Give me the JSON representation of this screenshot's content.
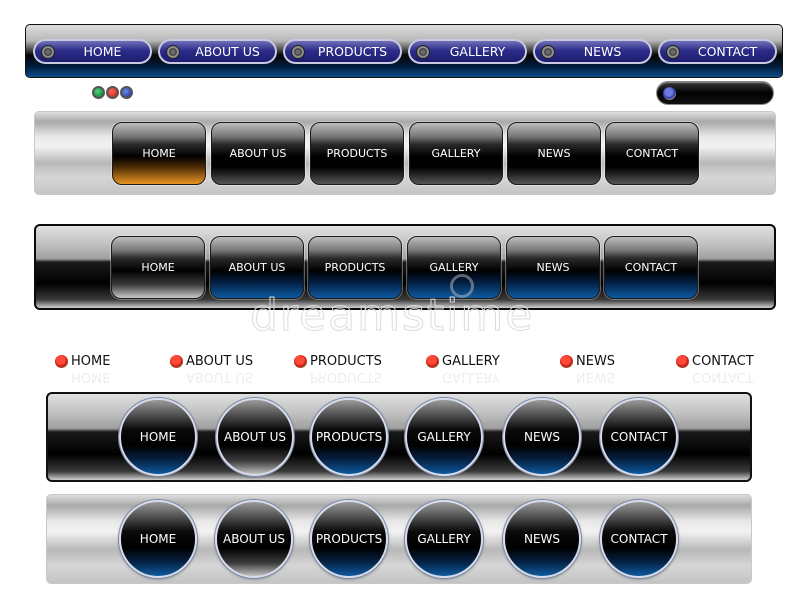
{
  "nav_labels": [
    "HOME",
    "ABOUT US",
    "PRODUCTS",
    "GALLERY",
    "NEWS",
    "CONTACT"
  ],
  "bar1": {
    "items": [
      {
        "label": "HOME"
      },
      {
        "label": "ABOUT US"
      },
      {
        "label": "PRODUCTS"
      },
      {
        "label": "GALLERY"
      },
      {
        "label": "NEWS"
      },
      {
        "label": "CONTACT"
      }
    ],
    "accent": "#2c2c8a"
  },
  "indicator_dots": [
    {
      "color": "green",
      "hex": "#0a7a2e"
    },
    {
      "color": "red",
      "hex": "#c11a10"
    },
    {
      "color": "blue",
      "hex": "#1a2e9a"
    }
  ],
  "search": {
    "value": "",
    "placeholder": ""
  },
  "bar2": {
    "items": [
      {
        "label": "HOME",
        "state": "active",
        "accent": "#e89420"
      },
      {
        "label": "ABOUT US"
      },
      {
        "label": "PRODUCTS"
      },
      {
        "label": "GALLERY"
      },
      {
        "label": "NEWS"
      },
      {
        "label": "CONTACT"
      }
    ]
  },
  "bar3": {
    "items": [
      {
        "label": "HOME",
        "state": "active"
      },
      {
        "label": "ABOUT US",
        "accent": "#0d5aa0"
      },
      {
        "label": "PRODUCTS",
        "accent": "#0d5aa0"
      },
      {
        "label": "GALLERY",
        "accent": "#0d5aa0"
      },
      {
        "label": "NEWS",
        "accent": "#0d5aa0"
      },
      {
        "label": "CONTACT",
        "accent": "#0d5aa0"
      }
    ]
  },
  "text_nav": {
    "items": [
      {
        "label": "HOME"
      },
      {
        "label": "ABOUT US"
      },
      {
        "label": "PRODUCTS"
      },
      {
        "label": "GALLERY"
      },
      {
        "label": "NEWS"
      },
      {
        "label": "CONTACT"
      }
    ],
    "bullet_color": "#d01a10"
  },
  "bar4": {
    "items": [
      {
        "label": "HOME"
      },
      {
        "label": "ABOUT US",
        "state": "active"
      },
      {
        "label": "PRODUCTS"
      },
      {
        "label": "GALLERY"
      },
      {
        "label": "NEWS"
      },
      {
        "label": "CONTACT"
      }
    ]
  },
  "bar5": {
    "items": [
      {
        "label": "HOME"
      },
      {
        "label": "ABOUT US",
        "state": "active"
      },
      {
        "label": "PRODUCTS"
      },
      {
        "label": "GALLERY"
      },
      {
        "label": "NEWS"
      },
      {
        "label": "CONTACT"
      }
    ]
  },
  "watermark": {
    "text": "dreamstime"
  }
}
